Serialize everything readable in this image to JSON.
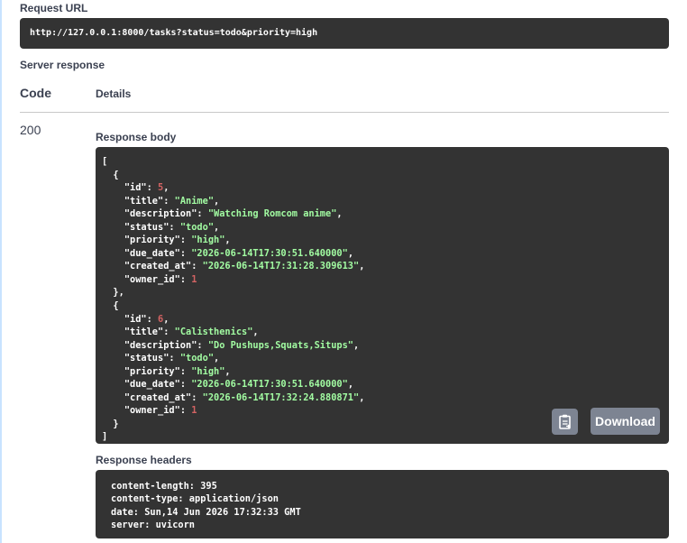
{
  "request_url": {
    "label": "Request URL",
    "value": "http://127.0.0.1:8000/tasks?status=todo&priority=high"
  },
  "server_response": {
    "label": "Server response",
    "code_header": "Code",
    "details_header": "Details",
    "status_code": "200"
  },
  "response_body": {
    "label": "Response body",
    "open_bracket": "[",
    "close_bracket": "]",
    "items": [
      {
        "id": "5",
        "title": "\"Anime\"",
        "description": "\"Watching Romcom anime\"",
        "status": "\"todo\"",
        "priority": "\"high\"",
        "due_date": "\"2026-06-14T17:30:51.640000\"",
        "created_at": "\"2026-06-14T17:31:28.309613\"",
        "owner_id": "1"
      },
      {
        "id": "6",
        "title": "\"Calisthenics\"",
        "description": "\"Do Pushups,Squats,Situps\"",
        "status": "\"todo\"",
        "priority": "\"high\"",
        "due_date": "\"2026-06-14T17:30:51.640000\"",
        "created_at": "\"2026-06-14T17:32:24.880871\"",
        "owner_id": "1"
      }
    ],
    "copy_icon": "clipboard-copy-icon",
    "download_label": "Download"
  },
  "response_headers": {
    "label": "Response headers",
    "lines": [
      "content-length: 395",
      "content-type: application/json",
      "date: Sun,14 Jun 2026 17:32:33 GMT",
      "server: uvicorn"
    ]
  },
  "colors": {
    "code_bg": "#333333",
    "string": "#a2fca2",
    "number": "#d36363",
    "button_bg": "#7d8492"
  }
}
